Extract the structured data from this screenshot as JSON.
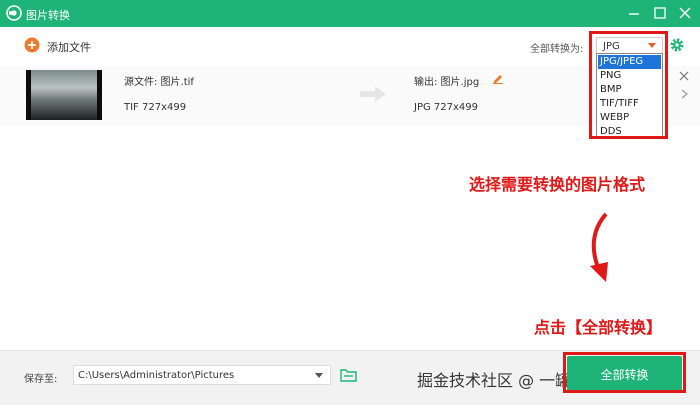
{
  "app": {
    "title": "图片转换",
    "accent": "#1eb477",
    "annotation_color": "#e01818"
  },
  "toolbar": {
    "add_label": "添加文件",
    "convert_all_label": "全部转换为:",
    "format_value": "JPG"
  },
  "file": {
    "source_name": "源文件: 图片.tif",
    "source_meta": "TIF  727x499",
    "output_name": "输出: 图片.jpg",
    "output_meta": "JPG  727x499"
  },
  "dropdown": {
    "options": [
      "JPG/JPEG",
      "PNG",
      "BMP",
      "TIF/TIFF",
      "WEBP",
      "DDS"
    ],
    "selected": "JPG/JPEG"
  },
  "annotations": {
    "step1": "选择需要转换的图片格式",
    "step2": "点击【全部转换】"
  },
  "bottom": {
    "save_label": "保存至:",
    "save_path": "C:\\Users\\Administrator\\Pictures",
    "convert_button": "全部转换",
    "watermark": "掘金技术社区 @ 一罐小可乐"
  }
}
